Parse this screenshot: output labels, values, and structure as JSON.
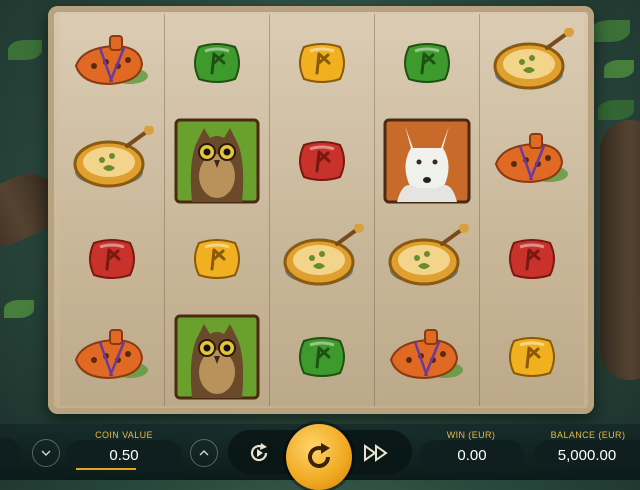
{
  "reels": [
    [
      "ocarina",
      "drum",
      "red-rune",
      "ocarina"
    ],
    [
      "green-rune",
      "owl",
      "yellow-rune",
      "owl"
    ],
    [
      "yellow-rune",
      "red-rune",
      "drum",
      "green-rune"
    ],
    [
      "green-rune",
      "wolf",
      "drum",
      "ocarina"
    ],
    [
      "drum",
      "ocarina",
      "red-rune",
      "yellow-rune"
    ]
  ],
  "controls": {
    "coin_value_label": "COIN VALUE",
    "coin_value": "0.50",
    "win_label": "WIN (EUR)",
    "win_value": "0.00",
    "balance_label": "BALANCE (EUR)",
    "balance_value": "5,000.00"
  },
  "colors": {
    "accent": "#f0a820",
    "label": "#e8b94a",
    "red_rune": "#c8322a",
    "green_rune": "#3f9a2e",
    "yellow_rune": "#f0b020"
  },
  "icons": {
    "autoplay": "autoplay-icon",
    "spin": "spin-icon",
    "fast": "fast-forward-icon",
    "coin_down": "chevron-down-icon",
    "coin_up": "chevron-up-icon"
  }
}
